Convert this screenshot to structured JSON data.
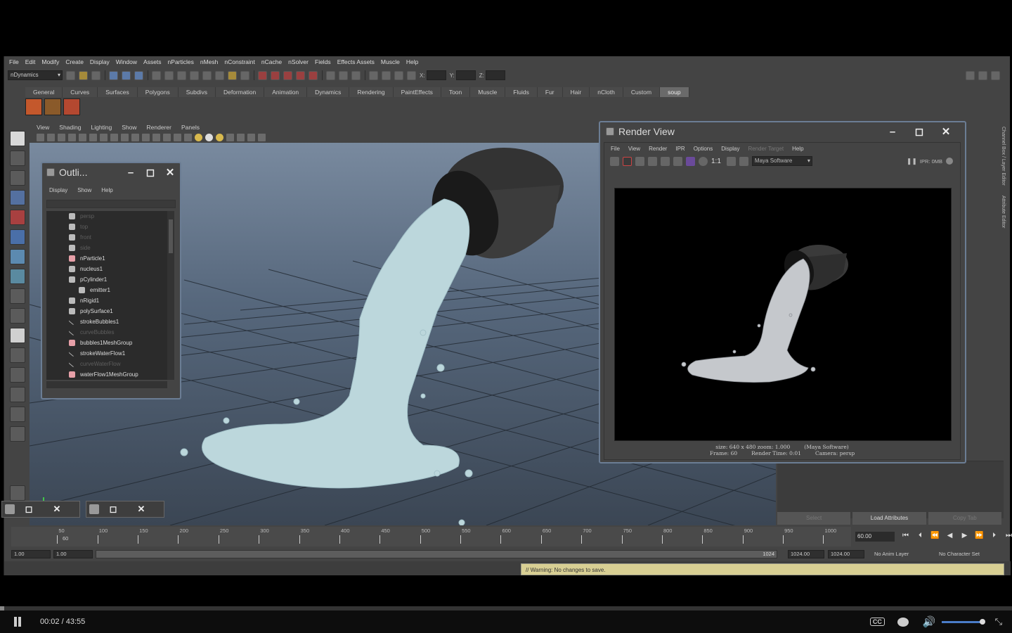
{
  "menubar": [
    "File",
    "Edit",
    "Modify",
    "Create",
    "Display",
    "Window",
    "Assets",
    "nParticles",
    "nMesh",
    "nConstraint",
    "nCache",
    "nSolver",
    "Fields",
    "Effects Assets",
    "Muscle",
    "Help"
  ],
  "statusline": {
    "mode": "nDynamics",
    "coord_x": "X:",
    "coord_y": "Y:",
    "coord_z": "Z:"
  },
  "shelf_tabs": [
    "General",
    "Curves",
    "Surfaces",
    "Polygons",
    "Subdivs",
    "Deformation",
    "Animation",
    "Dynamics",
    "Rendering",
    "PaintEffects",
    "Toon",
    "Muscle",
    "Fluids",
    "Fur",
    "Hair",
    "nCloth",
    "Custom",
    "soup"
  ],
  "shelf_active": "soup",
  "viewport_menu": [
    "View",
    "Shading",
    "Lighting",
    "Show",
    "Renderer",
    "Panels"
  ],
  "outliner": {
    "title": "Outli...",
    "menu": [
      "Display",
      "Show",
      "Help"
    ],
    "items": [
      {
        "label": "persp",
        "dim": true,
        "icon": "camera-icon"
      },
      {
        "label": "top",
        "dim": true,
        "icon": "camera-icon"
      },
      {
        "label": "front",
        "dim": true,
        "icon": "camera-icon"
      },
      {
        "label": "side",
        "dim": true,
        "icon": "camera-icon"
      },
      {
        "label": "nParticle1",
        "dim": false,
        "icon": "particle-icon"
      },
      {
        "label": "nucleus1",
        "dim": false,
        "icon": "nucleus-icon"
      },
      {
        "label": "pCylinder1",
        "dim": false,
        "icon": "mesh-icon"
      },
      {
        "label": "emitter1",
        "dim": false,
        "icon": "emitter-icon",
        "child": true
      },
      {
        "label": "nRigid1",
        "dim": false,
        "icon": "rigid-icon"
      },
      {
        "label": "polySurface1",
        "dim": false,
        "icon": "mesh-icon"
      },
      {
        "label": "strokeBubbles1",
        "dim": false,
        "icon": "stroke-icon"
      },
      {
        "label": "curveBubbles",
        "dim": true,
        "icon": "curve-icon"
      },
      {
        "label": "bubbles1MeshGroup",
        "dim": false,
        "icon": "group-icon"
      },
      {
        "label": "strokeWaterFlow1",
        "dim": false,
        "icon": "stroke-icon"
      },
      {
        "label": "curveWaterFlow",
        "dim": true,
        "icon": "curve-icon"
      },
      {
        "label": "waterFlow1MeshGroup",
        "dim": false,
        "icon": "group-icon"
      }
    ]
  },
  "render_view": {
    "title": "Render View",
    "menu": [
      "File",
      "View",
      "Render",
      "IPR",
      "Options",
      "Display",
      "Render Target",
      "Help"
    ],
    "ratio": "1:1",
    "renderer": "Maya Software",
    "ipr_label": "IPR: 0MB",
    "info": {
      "size": "size: 640 x 480 zoom: 1.000",
      "renderer": "(Maya Software)",
      "frame": "Frame: 60",
      "render_time": "Render Time: 0:01",
      "camera": "Camera: persp"
    }
  },
  "attr_buttons": [
    "Select",
    "Load Attributes",
    "Copy Tab"
  ],
  "side_tabs": [
    "Channel Box / Layer Editor",
    "Attribute Editor"
  ],
  "timeline": {
    "ticks": [
      "50",
      "60",
      "100",
      "150",
      "200",
      "250",
      "300",
      "350",
      "400",
      "450",
      "500",
      "550",
      "600",
      "650",
      "700",
      "750",
      "800",
      "850",
      "900",
      "950",
      "1000"
    ],
    "current_frame": "60.00"
  },
  "range": {
    "start": "1.00",
    "start2": "1.00",
    "range_end_label": "1024",
    "end": "1024.00",
    "end2": "1024.00",
    "anim_layer": "No Anim Layer",
    "char_set": "No Character Set"
  },
  "warning": "// Warning: No changes to save.",
  "player": {
    "current": "00:02",
    "separator": "/",
    "total": "43:55",
    "cc": "CC"
  },
  "colors": {
    "window_border": "#6b7d94",
    "warning_bg": "#d8cf93",
    "volume": "#4a7cc8"
  }
}
